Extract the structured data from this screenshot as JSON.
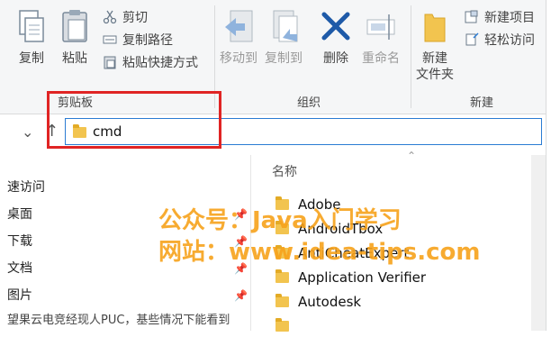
{
  "ribbon": {
    "clipboard": {
      "copy": "复制",
      "paste": "粘贴",
      "cut": "剪切",
      "copy_path": "复制路径",
      "paste_shortcut": "粘贴快捷方式",
      "group_label": "剪贴板"
    },
    "organize": {
      "move_to": "移动到",
      "copy_to": "复制到",
      "delete": "删除",
      "rename": "重命名",
      "group_label": "组织"
    },
    "new": {
      "new_folder_line1": "新建",
      "new_folder_line2": "文件夹",
      "new_item": "新建项目",
      "easy_access": "轻松访问",
      "group_label": "新建"
    }
  },
  "address": {
    "path": "cmd"
  },
  "navigation": {
    "items": [
      {
        "label": "速访问"
      },
      {
        "label": "桌面"
      },
      {
        "label": "下载"
      },
      {
        "label": "文档"
      },
      {
        "label": "图片"
      },
      {
        "label": "望果云电竞经现人PUC，基些情况下能看到"
      }
    ]
  },
  "file_list": {
    "column_name": "名称",
    "items": [
      "Adobe",
      "AndroidTbox",
      "AntiCheatExpert",
      "Application Verifier",
      "Autodesk"
    ]
  },
  "watermark": {
    "line1": "公众号：Java入门学习",
    "line2": "网站：www.idea-tips.com"
  },
  "colors": {
    "accent": "#2b7cd3",
    "highlight": "#e02424",
    "watermark": "#f7a21b",
    "folder": "#f2c44f",
    "delete_x": "#1e5aa8"
  }
}
